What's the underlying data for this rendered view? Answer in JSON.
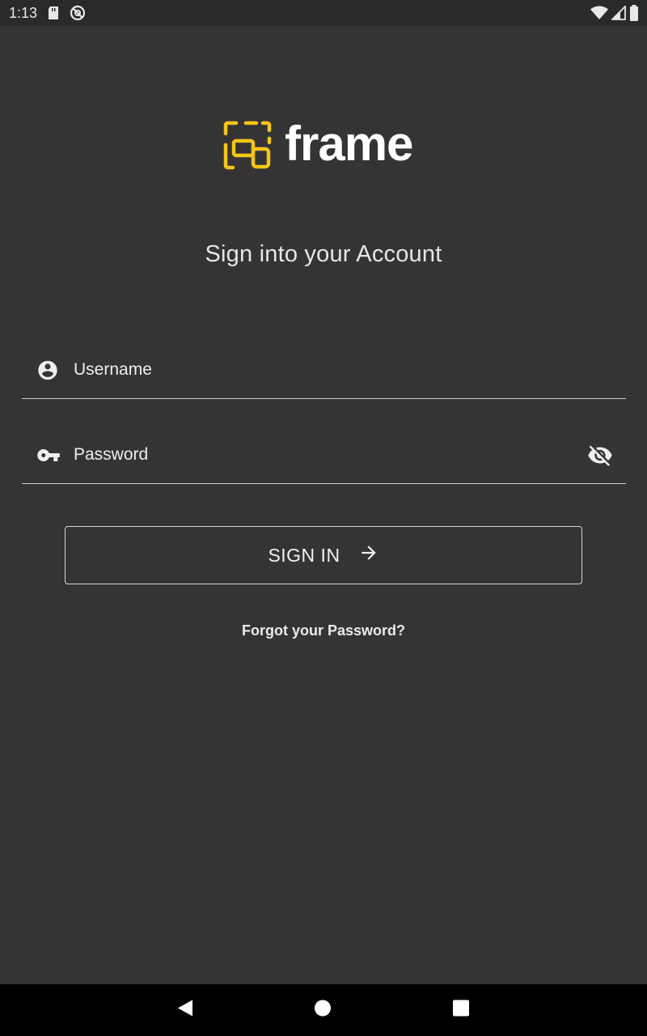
{
  "status_bar": {
    "time": "1:13",
    "left_icons": [
      "sd-card-icon",
      "do-not-disturb-icon"
    ],
    "right_icons": [
      "wifi-icon",
      "cellular-signal-icon",
      "battery-icon"
    ]
  },
  "logo": {
    "text": "frame",
    "accent_color": "#F5C518",
    "icon": "frame-logo-icon"
  },
  "heading": "Sign into your Account",
  "username_field": {
    "placeholder": "Username",
    "value": "",
    "icon": "account-circle-icon"
  },
  "password_field": {
    "placeholder": "Password",
    "value": "",
    "icon": "key-icon",
    "toggle_icon": "visibility-off-icon"
  },
  "sign_in_button": {
    "label": "SIGN IN",
    "icon": "arrow-right-icon"
  },
  "forgot_password": "Forgot your Password?",
  "nav_bar": {
    "buttons": [
      "back-icon",
      "home-icon",
      "recents-icon"
    ]
  },
  "colors": {
    "background": "#353334",
    "status_bar": "#2B2A2B",
    "nav_bar": "#000000",
    "text": "#FFFFFF"
  }
}
